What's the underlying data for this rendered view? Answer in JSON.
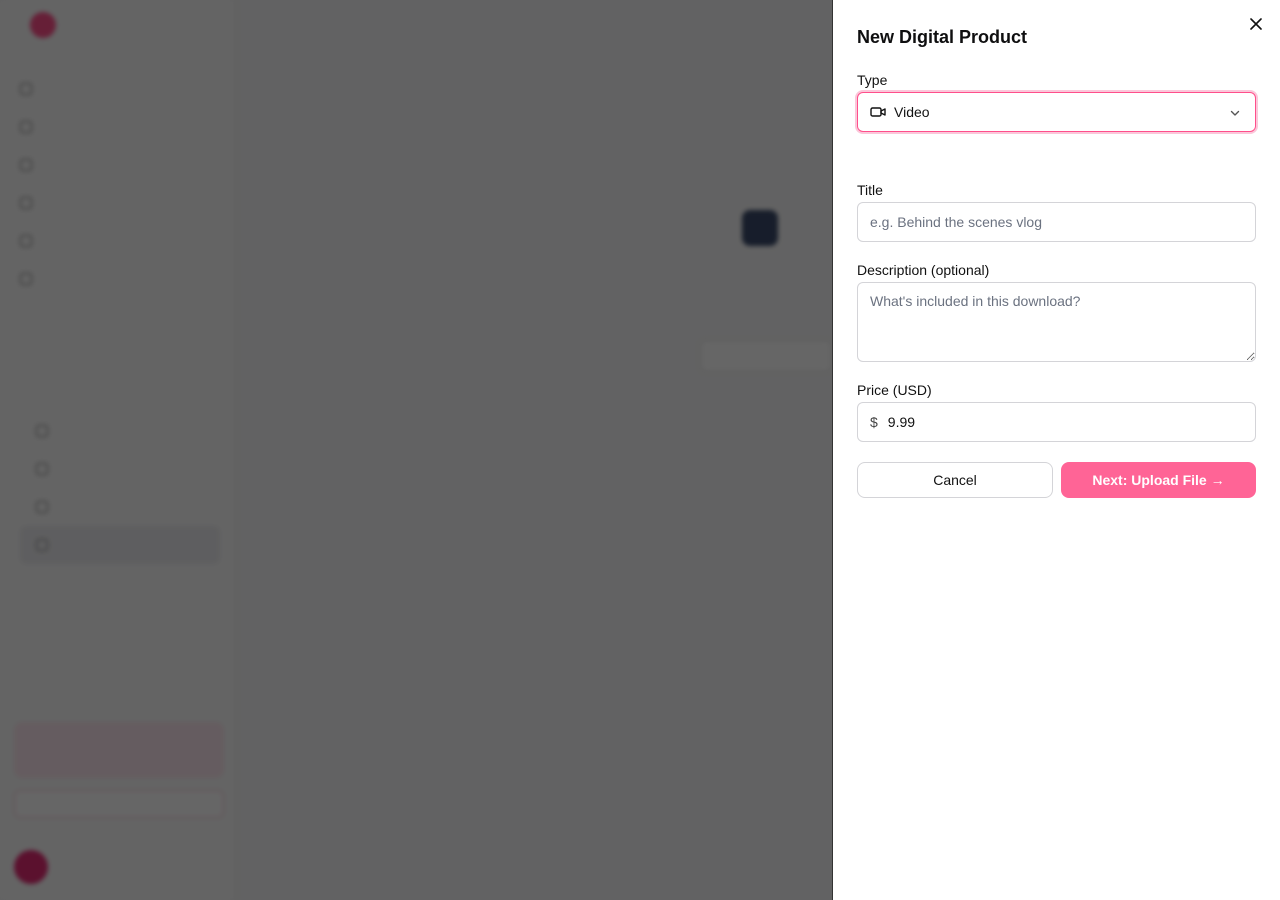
{
  "drawer": {
    "title": "New Digital Product",
    "type_label": "Type",
    "type_value": "Video",
    "type_icon": "video-camera-icon",
    "title_label": "Title",
    "title_placeholder": "e.g. Behind the scenes vlog",
    "description_label": "Description (optional)",
    "description_placeholder": "What's included in this download?",
    "price_label": "Price (USD)",
    "currency_symbol": "$",
    "price_value": "9.99",
    "cancel_label": "Cancel",
    "next_label": "Next: Upload File →"
  },
  "colors": {
    "accent": "#ff4f8b",
    "button_primary": "#ff6496",
    "overlay": "rgba(0,0,0,0.6)"
  }
}
